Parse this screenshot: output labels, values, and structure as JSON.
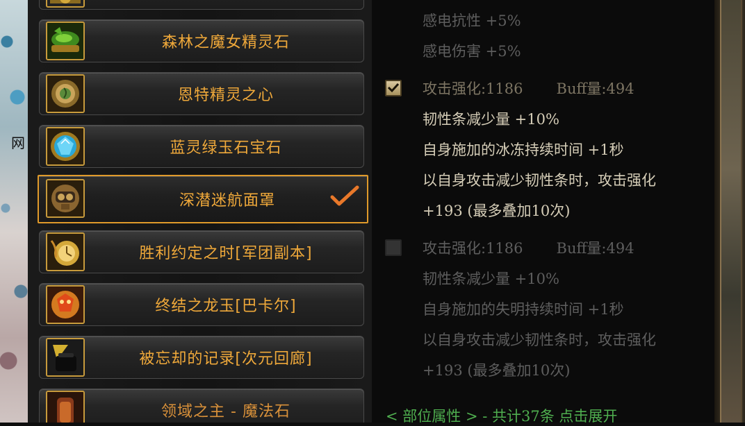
{
  "wallpaper": {
    "char": "网"
  },
  "items": [
    {
      "label": "",
      "icon": "partial-item-icon"
    },
    {
      "label": "森林之魔女精灵石",
      "icon": "green-stone-icon"
    },
    {
      "label": "恩特精灵之心",
      "icon": "ent-heart-icon"
    },
    {
      "label": "蓝灵绿玉石宝石",
      "icon": "blue-gem-icon"
    },
    {
      "label": "深潜迷航面罩",
      "icon": "diving-mask-icon",
      "selected": true
    },
    {
      "label": "胜利约定之时[军团副本]",
      "icon": "golden-watch-icon"
    },
    {
      "label": "终结之龙玉[巴卡尔]",
      "icon": "dragon-jade-icon"
    },
    {
      "label": "被忘却的记录[次元回廊]",
      "icon": "forgotten-record-icon"
    },
    {
      "label": "领域之主 - 魔法石",
      "icon": "domain-stone-icon"
    }
  ],
  "details": {
    "top_lines": [
      "感电抗性 +5%",
      "感电伤害 +5%"
    ],
    "option_a": {
      "checked": true,
      "attack": "攻击强化:1186",
      "buff": "Buff量:494",
      "lines": [
        "韧性条减少量 +10%",
        "自身施加的冰冻持续时间 +1秒",
        "以自身攻击减少韧性条时，攻击强化",
        "+193 (最多叠加10次)"
      ]
    },
    "option_b": {
      "checked": false,
      "attack": "攻击强化:1186",
      "buff": "Buff量:494",
      "lines": [
        "韧性条减少量 +10%",
        "自身施加的失明持续时间 +1秒",
        "以自身攻击减少韧性条时，攻击强化",
        "+193 (最多叠加10次)"
      ]
    },
    "footer": "< 部位属性 > - 共计37条 点击展开"
  },
  "colors": {
    "item_label": "#f0a93a",
    "selected_border": "#e09a2a",
    "footer_green": "#4fae4f"
  }
}
